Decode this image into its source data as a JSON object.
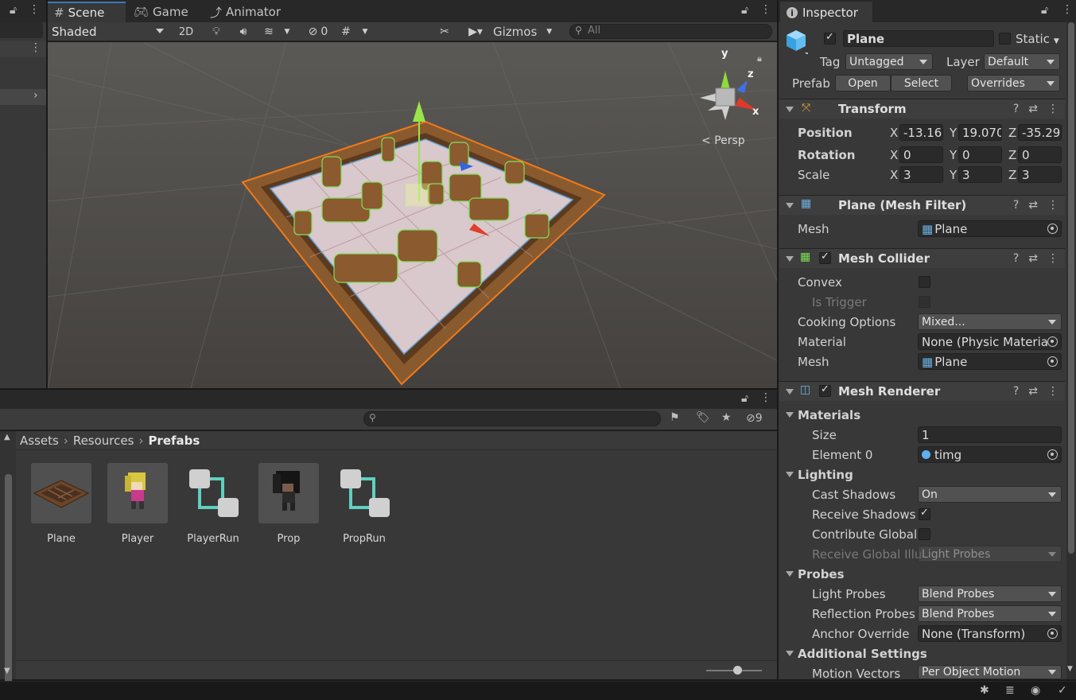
{
  "scene_tabs": {
    "scene": "Scene",
    "game": "Game",
    "animator": "Animator"
  },
  "scene_toolbar": {
    "shading": "Shaded",
    "mode_2d": "2D",
    "hidden_count": "0",
    "gizmos": "Gizmos",
    "search_placeholder": "All"
  },
  "scene_view": {
    "persp_label": "Persp",
    "axis_x": "x",
    "axis_y": "y",
    "axis_z": "z"
  },
  "project": {
    "hidden_count": "9",
    "breadcrumb": [
      "Assets",
      "Resources",
      "Prefabs"
    ],
    "assets": [
      {
        "name": "Plane",
        "type": "plane-prefab-thumbnail"
      },
      {
        "name": "Player",
        "type": "player-prefab-thumbnail"
      },
      {
        "name": "PlayerRun",
        "type": "animator-controller-icon"
      },
      {
        "name": "Prop",
        "type": "prop-prefab-thumbnail"
      },
      {
        "name": "PropRun",
        "type": "animator-controller-icon"
      }
    ]
  },
  "inspector": {
    "tab": "Inspector",
    "object_name": "Plane",
    "static_label": "Static",
    "tag_label": "Tag",
    "tag_value": "Untagged",
    "layer_label": "Layer",
    "layer_value": "Default",
    "prefab_label": "Prefab",
    "open_label": "Open",
    "select_label": "Select",
    "overrides_label": "Overrides",
    "transform": {
      "title": "Transform",
      "position_label": "Position",
      "rotation_label": "Rotation",
      "scale_label": "Scale",
      "x": "X",
      "y": "Y",
      "z": "Z",
      "position": [
        "-13.16",
        "19.070",
        "-35.29"
      ],
      "rotation": [
        "0",
        "0",
        "0"
      ],
      "scale": [
        "3",
        "3",
        "3"
      ]
    },
    "mesh_filter": {
      "title": "Plane (Mesh Filter)",
      "mesh_label": "Mesh",
      "mesh_value": "Plane"
    },
    "mesh_collider": {
      "title": "Mesh Collider",
      "convex_label": "Convex",
      "is_trigger_label": "Is Trigger",
      "cooking_label": "Cooking Options",
      "cooking_value": "Mixed...",
      "material_label": "Material",
      "material_value": "None (Physic Materia",
      "mesh_label": "Mesh",
      "mesh_value": "Plane"
    },
    "mesh_renderer": {
      "title": "Mesh Renderer",
      "materials_label": "Materials",
      "size_label": "Size",
      "size_value": "1",
      "element0_label": "Element 0",
      "element0_value": "timg",
      "lighting_label": "Lighting",
      "cast_shadows_label": "Cast Shadows",
      "cast_shadows_value": "On",
      "receive_shadows_label": "Receive Shadows",
      "contribute_global_label": "Contribute Global",
      "receive_gi_label": "Receive Global Illu",
      "receive_gi_value": "Light Probes",
      "probes_label": "Probes",
      "light_probes_label": "Light Probes",
      "light_probes_value": "Blend Probes",
      "reflection_probes_label": "Reflection Probes",
      "reflection_probes_value": "Blend Probes",
      "anchor_override_label": "Anchor Override",
      "anchor_override_value": "None (Transform)",
      "additional_settings_label": "Additional Settings",
      "motion_vectors_label": "Motion Vectors",
      "motion_vectors_value": "Per Object Motion"
    }
  },
  "colors": {
    "accent": "#3a79bb",
    "selection_outline": "#f07a1a",
    "wire": "#7ee25a"
  }
}
